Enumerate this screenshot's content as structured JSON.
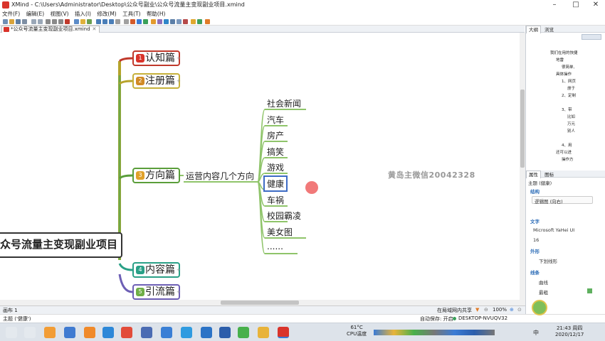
{
  "window": {
    "title": "XMind - C:\\Users\\Administrator\\Desktop\\公众号副业\\公众号流量主变现副业项目.xmind",
    "controls": [
      "–",
      "□",
      "✕"
    ]
  },
  "menu": [
    "文件(F)",
    "编辑(E)",
    "视图(V)",
    "插入(I)",
    "修改(M)",
    "工具(T)",
    "帮助(H)"
  ],
  "tab": {
    "label": "*公众号流量主变现副业项目.xmind",
    "close": "✕"
  },
  "mindmap": {
    "central": "众号流量主变现副业项目",
    "branches": [
      {
        "num": "1",
        "label": "认知篇",
        "color": "#c0392b"
      },
      {
        "num": "2",
        "label": "注册篇",
        "color": "#b8860b"
      },
      {
        "num": "3",
        "label": "方向篇",
        "color": "#5a9e3a"
      },
      {
        "num": "4",
        "label": "内容篇",
        "color": "#2aa087"
      },
      {
        "num": "5",
        "label": "引流篇",
        "color": "#6d5fb5"
      }
    ],
    "subtopic": "运营内容几个方向",
    "leaves": [
      "社会新闻",
      "汽车",
      "房产",
      "搞笑",
      "游戏",
      "健康",
      "车祸",
      "校园霸凌",
      "美女图",
      "......"
    ],
    "plus": "+"
  },
  "watermark": "黄岛主微信20042328",
  "bottom": {
    "sheet": "画布 1",
    "share": "在局域网内共享",
    "zoom": "100%"
  },
  "status": {
    "topic": "主题 ('健康')",
    "autosave": "自动保存: 开启",
    "machine": "DESKTOP-NVUQV32"
  },
  "panel": {
    "tabs": [
      "大纲",
      "浏览"
    ],
    "outline": [
      "我们在用的快捷",
      "地雷",
      "很简单,",
      "具体操作",
      "1、网页",
      "册于",
      "2、定制",
      "3、带",
      "比如",
      "万元",
      "别人",
      "4、用",
      "还可以进",
      "操作方"
    ],
    "prop_tabs": [
      "属性",
      "图标"
    ],
    "prop_title": "主题 (健康)",
    "sections": {
      "structure": "结构",
      "structure_value": "逻辑图 (向右)",
      "text": "文字",
      "font": "Microsoft YaHei UI",
      "size": "16",
      "shape": "外形",
      "shape_value": "下划线形",
      "line": "线条",
      "line_curve": "曲线",
      "line_width": "最粗"
    }
  },
  "taskbar": {
    "temp": "61°C",
    "cpu": "CPU温度",
    "ime": "中",
    "time": "21:43 周四",
    "date": "2020/12/17"
  }
}
